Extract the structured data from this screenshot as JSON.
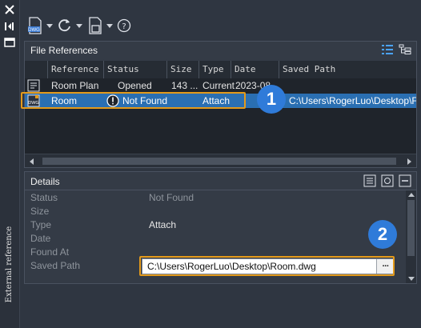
{
  "panel": {
    "vertical_title": "External reference",
    "file_references_title": "File References",
    "details_title": "Details"
  },
  "toolbar": {
    "attach_dwg_label": "DWG",
    "refresh_label": "",
    "change_path_label": ""
  },
  "grid": {
    "headers": [
      "Reference N",
      "Status",
      "Size",
      "Type",
      "Date",
      "Saved Path"
    ],
    "rows": [
      {
        "icon": "dwg-master-icon",
        "name": "Room Plan",
        "status": "Opened",
        "size": "143 ...",
        "type": "Current",
        "date": "2023-08",
        "saved_path": ""
      },
      {
        "icon": "dwg-file-icon",
        "name": "Room",
        "status": "Not Found",
        "size": "",
        "type": "Attach",
        "date": "",
        "saved_path": "C:\\Users\\RogerLuo\\Desktop\\F"
      }
    ]
  },
  "details": {
    "rows": [
      {
        "label": "Status",
        "value": "Not Found"
      },
      {
        "label": "Size",
        "value": ""
      },
      {
        "label": "Type",
        "value": "Attach"
      },
      {
        "label": "Date",
        "value": ""
      },
      {
        "label": "Found At",
        "value": ""
      },
      {
        "label": "Saved Path",
        "value": ""
      }
    ],
    "saved_path_value": "C:\\Users\\RogerLuo\\Desktop\\Room.dwg",
    "browse_label": "···"
  },
  "annotations": {
    "badge_1": "1",
    "badge_2": "2"
  },
  "colors": {
    "selection": "#2a6fb2",
    "highlight": "#e39a1b",
    "badge": "#2f7bd9"
  }
}
